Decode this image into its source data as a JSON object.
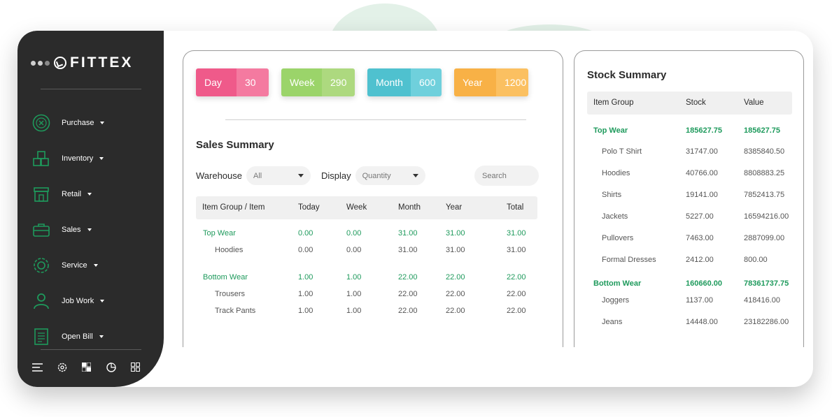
{
  "brand": "FITTEX",
  "nav": [
    {
      "label": "Purchase",
      "icon": "purchase-icon"
    },
    {
      "label": "Inventory",
      "icon": "inventory-icon"
    },
    {
      "label": "Retail",
      "icon": "retail-icon"
    },
    {
      "label": "Sales",
      "icon": "sales-icon"
    },
    {
      "label": "Service",
      "icon": "service-icon"
    },
    {
      "label": "Job Work",
      "icon": "job-work-icon"
    },
    {
      "label": "Open Bill",
      "icon": "open-bill-icon"
    }
  ],
  "stats": {
    "day": {
      "label": "Day",
      "value": "30"
    },
    "week": {
      "label": "Week",
      "value": "290"
    },
    "month": {
      "label": "Month",
      "value": "600"
    },
    "year": {
      "label": "Year",
      "value": "1200"
    }
  },
  "sales": {
    "title": "Sales Summary",
    "warehouse_label": "Warehouse",
    "warehouse_value": "All",
    "display_label": "Display",
    "display_value": "Quantity",
    "search_placeholder": "Search",
    "columns": [
      "Item Group / Item",
      "Today",
      "Week",
      "Month",
      "Year",
      "Total"
    ],
    "rows": [
      {
        "name": "Top Wear",
        "group": true,
        "values": [
          "0.00",
          "0.00",
          "31.00",
          "31.00",
          "31.00"
        ]
      },
      {
        "name": "Hoodies",
        "group": false,
        "values": [
          "0.00",
          "0.00",
          "31.00",
          "31.00",
          "31.00"
        ]
      },
      {
        "name": "Bottom Wear",
        "group": true,
        "values": [
          "1.00",
          "1.00",
          "22.00",
          "22.00",
          "22.00"
        ]
      },
      {
        "name": "Trousers",
        "group": false,
        "values": [
          "1.00",
          "1.00",
          "22.00",
          "22.00",
          "22.00"
        ]
      },
      {
        "name": "Track Pants",
        "group": false,
        "values": [
          "1.00",
          "1.00",
          "22.00",
          "22.00",
          "22.00"
        ]
      }
    ]
  },
  "stock": {
    "title": "Stock Summary",
    "columns": [
      "Item Group",
      "Stock",
      "Value"
    ],
    "rows": [
      {
        "name": "Top Wear",
        "group": true,
        "stock": "185627.75",
        "value": "185627.75"
      },
      {
        "name": "Polo T Shirt",
        "group": false,
        "stock": "31747.00",
        "value": "8385840.50"
      },
      {
        "name": "Hoodies",
        "group": false,
        "stock": "40766.00",
        "value": "8808883.25"
      },
      {
        "name": "Shirts",
        "group": false,
        "stock": "19141.00",
        "value": "7852413.75"
      },
      {
        "name": "Jackets",
        "group": false,
        "stock": "5227.00",
        "value": "16594216.00"
      },
      {
        "name": "Pullovers",
        "group": false,
        "stock": "7463.00",
        "value": "2887099.00"
      },
      {
        "name": "Formal Dresses",
        "group": false,
        "stock": "2412.00",
        "value": "800.00"
      },
      {
        "name": "Bottom Wear",
        "group": true,
        "stock": "160660.00",
        "value": "78361737.75"
      },
      {
        "name": "Joggers",
        "group": false,
        "stock": "1137.00",
        "value": "418416.00"
      },
      {
        "name": "Jeans",
        "group": false,
        "stock": "14448.00",
        "value": "23182286.00"
      }
    ]
  },
  "colors": {
    "accent": "#1e9a5c",
    "sidebar": "#2b2b2b",
    "day": "#ef5a8a",
    "week": "#9bd46a",
    "month": "#4fc1cf",
    "year": "#f8b146"
  }
}
